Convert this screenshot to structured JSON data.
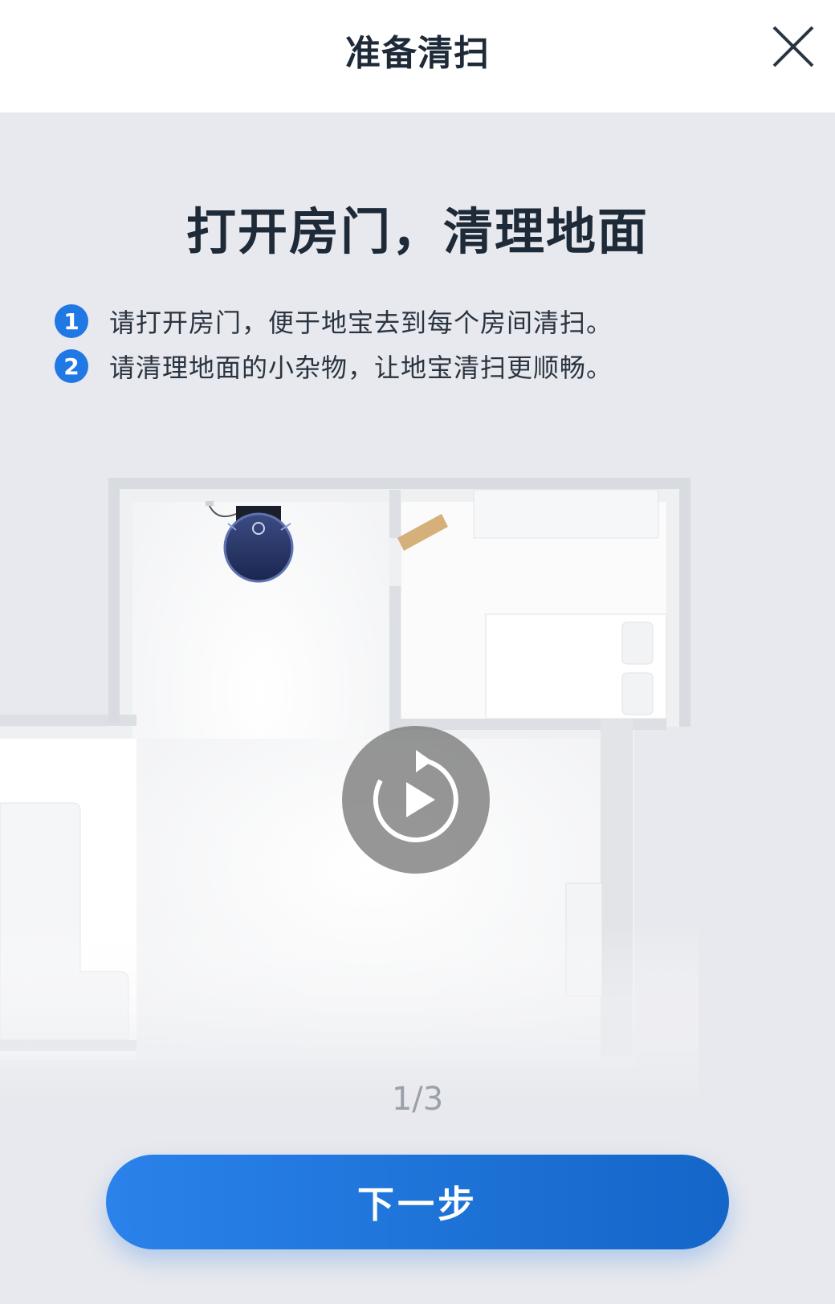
{
  "header": {
    "title": "准备清扫",
    "close_icon": "close-icon"
  },
  "main": {
    "title": "打开房门，清理地面",
    "steps": [
      {
        "number": "1",
        "text": "请打开房门，便于地宝去到每个房间清扫。"
      },
      {
        "number": "2",
        "text": "请清理地面的小杂物，让地宝清扫更顺畅。"
      }
    ]
  },
  "illustration": {
    "replay_icon": "replay-icon",
    "robot_icon": "robot-vacuum-icon"
  },
  "pager": "1/3",
  "footer": {
    "next_label": "下一步"
  },
  "colors": {
    "accent": "#1f78e3",
    "background": "#e8e9ee",
    "title": "#1e2a38"
  }
}
